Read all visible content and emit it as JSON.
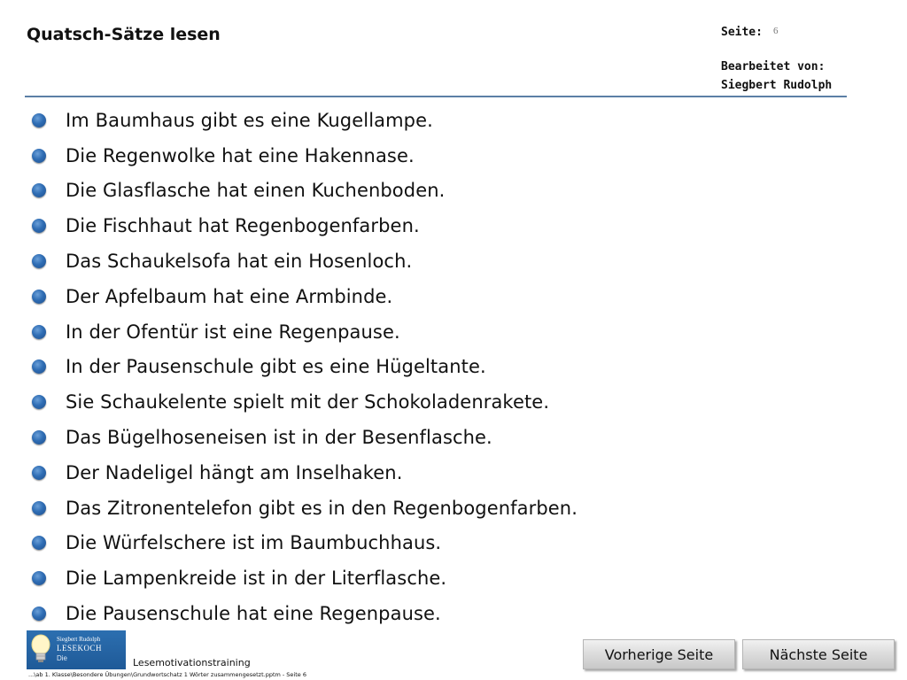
{
  "header": {
    "title": "Quatsch-Sätze lesen",
    "page_label": "Seite:",
    "page_number": "6",
    "edited_label": "Bearbeitet von:",
    "editor": "Siegbert Rudolph"
  },
  "sentences": [
    "Im Baumhaus gibt es eine Kugellampe.",
    "Die Regenwolke hat eine Hakennase.",
    "Die Glasflasche hat einen Kuchenboden.",
    "Die Fischhaut hat Regenbogenfarben.",
    "Das Schaukelsofa hat ein Hosenloch.",
    "Der Apfelbaum hat eine Armbinde.",
    "In der Ofentür ist eine Regenpause.",
    "In der Pausenschule gibt es eine Hügeltante.",
    "Sie Schaukelente spielt mit der Schokoladenrakete.",
    "Das Bügelhoseneisen ist in der Besenflasche.",
    "Der Nadeligel hängt am Inselhaken.",
    "Das Zitronentelefon gibt es in den Regenbogenfarben.",
    "Die Würfelschere ist im Baumbuchhaus.",
    "Die Lampenkreide ist in der Literflasche.",
    "Die Pausenschule hat eine Regenpause."
  ],
  "logo": {
    "line1": "Siegbert Rudolph",
    "line2": "LESEKOCH",
    "line3": "Die"
  },
  "footer": {
    "label": "Lesemotivationstraining",
    "path": "...\\ab 1. Klasse\\Besondere Übungen\\Grundwortschatz 1 Wörter zusammengesetzt.pptm - Seite 6"
  },
  "nav": {
    "prev_label": "Vorherige Seite",
    "next_label": "Nächste Seite"
  },
  "colors": {
    "rule": "#5b7fa6",
    "bullet": "#2f6db4",
    "logo_bg": "#1f5a98"
  }
}
